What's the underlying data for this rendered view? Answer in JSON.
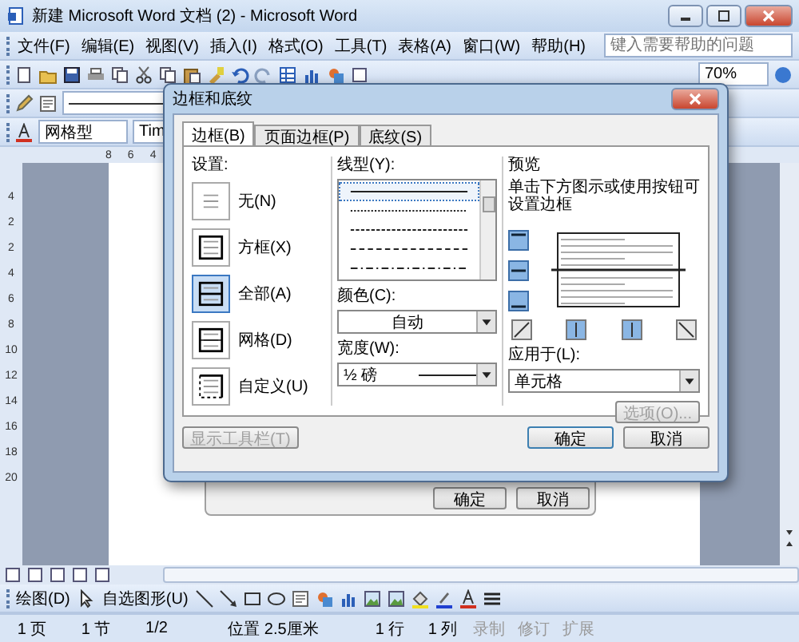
{
  "window": {
    "title": "新建 Microsoft Word 文档 (2) - Microsoft Word"
  },
  "menu": [
    {
      "label": "文件(F)"
    },
    {
      "label": "编辑(E)"
    },
    {
      "label": "视图(V)"
    },
    {
      "label": "插入(I)"
    },
    {
      "label": "格式(O)"
    },
    {
      "label": "工具(T)"
    },
    {
      "label": "表格(A)"
    },
    {
      "label": "窗口(W)"
    },
    {
      "label": "帮助(H)"
    }
  ],
  "help_box": {
    "placeholder": "键入需要帮助的问题"
  },
  "standard_toolbar": {
    "zoom": "70%"
  },
  "format_toolbar": {
    "style": "网格型",
    "font": "Tim"
  },
  "ruler": {
    "marks": [
      "8",
      "6",
      "4"
    ]
  },
  "vertical_ruler": {
    "marks": [
      "4",
      "2",
      "2",
      "4",
      "6",
      "8",
      "10",
      "12",
      "14",
      "16",
      "18",
      "20"
    ]
  },
  "background_dialog": {
    "buttons": [
      "确定",
      "取消"
    ]
  },
  "dialog": {
    "title": "边框和底纹",
    "tabs": [
      {
        "label": "边框(B)",
        "selected": true
      },
      {
        "label": "页面边框(P)",
        "selected": false
      },
      {
        "label": "底纹(S)",
        "selected": false
      }
    ],
    "settings_label": "设置:",
    "settings": [
      {
        "kind": "none",
        "label": "无(N)",
        "selected": false
      },
      {
        "kind": "box",
        "label": "方框(X)",
        "selected": false
      },
      {
        "kind": "all",
        "label": "全部(A)",
        "selected": true
      },
      {
        "kind": "grid",
        "label": "网格(D)",
        "selected": false
      },
      {
        "kind": "custom",
        "label": "自定义(U)",
        "selected": false
      }
    ],
    "line_style_label": "线型(Y):",
    "line_styles": [
      {
        "kind": "solid",
        "selected": true
      },
      {
        "kind": "dotted",
        "selected": false
      },
      {
        "kind": "fine-dash",
        "selected": false
      },
      {
        "kind": "dash",
        "selected": false
      },
      {
        "kind": "dash-dot",
        "selected": false
      }
    ],
    "color_label": "颜色(C):",
    "color_value": "自动",
    "width_label": "宽度(W):",
    "width_value": "½ 磅",
    "preview_label": "预览",
    "preview_hint": "单击下方图示或使用按钮可设置边框",
    "apply_label": "应用于(L):",
    "apply_value": "单元格",
    "options_button": {
      "label": "选项(O)...",
      "disabled": true
    },
    "toolbar_button": {
      "label": "显示工具栏(T)",
      "disabled": true
    },
    "buttons": [
      "确定",
      "取消"
    ]
  },
  "drawing_toolbar": {
    "draw": "绘图(D)",
    "autoshapes": "自选图形(U)"
  },
  "status_bar": [
    {
      "text": "1 页",
      "disabled": false
    },
    {
      "text": "1 节",
      "disabled": false
    },
    {
      "text": "1/2",
      "disabled": false
    },
    {
      "text": "位置 2.5厘米",
      "disabled": false
    },
    {
      "text": "1 行",
      "disabled": false
    },
    {
      "text": "1 列",
      "disabled": false
    },
    {
      "text": "录制",
      "disabled": true
    },
    {
      "text": "修订",
      "disabled": true
    },
    {
      "text": "扩展",
      "disabled": true
    }
  ]
}
